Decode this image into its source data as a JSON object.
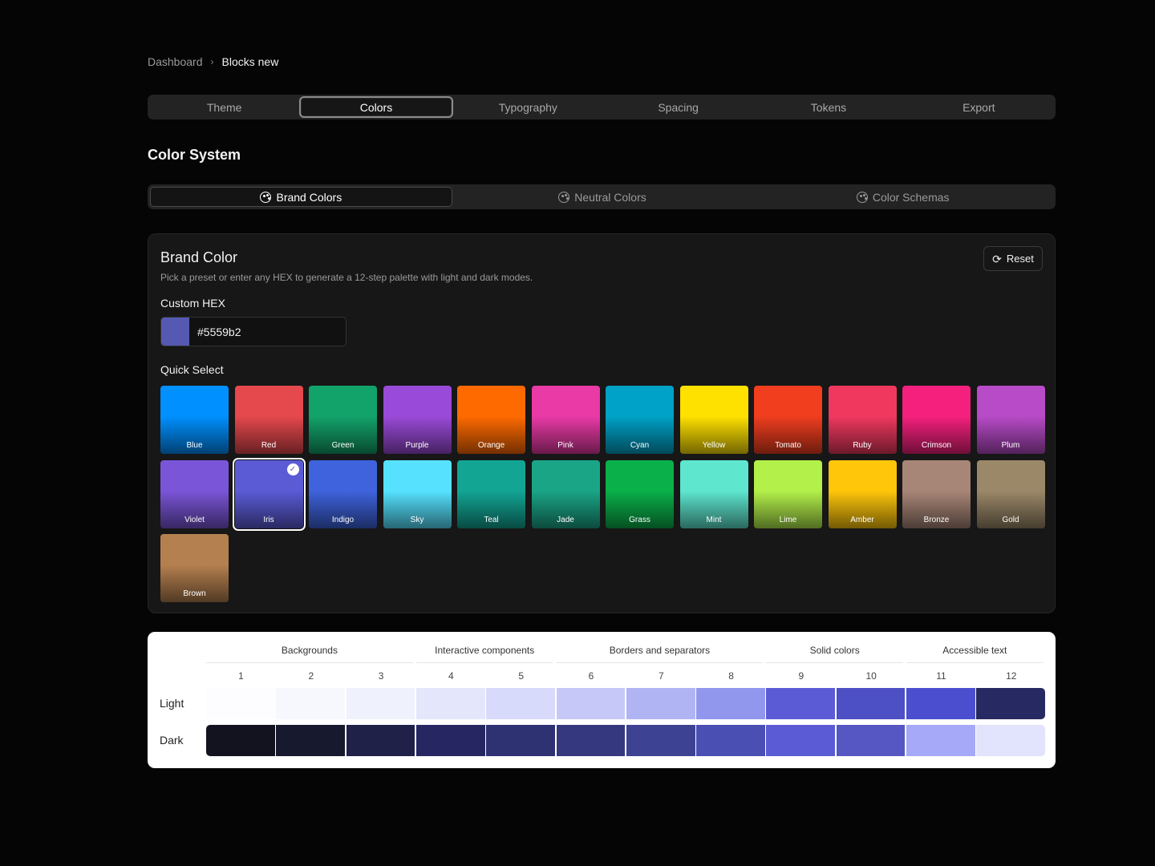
{
  "breadcrumb": {
    "root": "Dashboard",
    "separator": "›",
    "current": "Blocks new"
  },
  "main_tabs": [
    {
      "label": "Theme",
      "active": false
    },
    {
      "label": "Colors",
      "active": true
    },
    {
      "label": "Typography",
      "active": false
    },
    {
      "label": "Spacing",
      "active": false
    },
    {
      "label": "Tokens",
      "active": false
    },
    {
      "label": "Export",
      "active": false
    }
  ],
  "section_title": "Color System",
  "sub_tabs": [
    {
      "label": "Brand Colors",
      "icon": "palette-icon",
      "active": true
    },
    {
      "label": "Neutral Colors",
      "icon": "palette-icon",
      "active": false
    },
    {
      "label": "Color Schemas",
      "icon": "palette-icon",
      "active": false
    }
  ],
  "brand_card": {
    "title": "Brand Color",
    "description": "Pick a preset or enter any HEX to generate a 12-step palette with light and dark modes.",
    "reset_label": "Reset",
    "reset_icon": "refresh-icon",
    "hex_label": "Custom HEX",
    "hex_value": "#5559b2",
    "hex_swatch_color": "#5559b2",
    "quick_select_label": "Quick Select",
    "selected": "Iris",
    "presets": [
      {
        "name": "Blue",
        "color": "#0090ff"
      },
      {
        "name": "Red",
        "color": "#e5484d"
      },
      {
        "name": "Green",
        "color": "#12a36a"
      },
      {
        "name": "Purple",
        "color": "#9a4ad8"
      },
      {
        "name": "Orange",
        "color": "#ff6a00"
      },
      {
        "name": "Pink",
        "color": "#e93aa6"
      },
      {
        "name": "Cyan",
        "color": "#00a2c7"
      },
      {
        "name": "Yellow",
        "color": "#ffe100"
      },
      {
        "name": "Tomato",
        "color": "#f03e1f"
      },
      {
        "name": "Ruby",
        "color": "#f0385f"
      },
      {
        "name": "Crimson",
        "color": "#f5207d"
      },
      {
        "name": "Plum",
        "color": "#b84bc8"
      },
      {
        "name": "Violet",
        "color": "#7b55d8"
      },
      {
        "name": "Iris",
        "color": "#5b5bd6"
      },
      {
        "name": "Indigo",
        "color": "#3e63dd"
      },
      {
        "name": "Sky",
        "color": "#56e2ff"
      },
      {
        "name": "Teal",
        "color": "#12a594"
      },
      {
        "name": "Jade",
        "color": "#1aa587"
      },
      {
        "name": "Grass",
        "color": "#0ab04a"
      },
      {
        "name": "Mint",
        "color": "#5ee6cf"
      },
      {
        "name": "Lime",
        "color": "#b3f04a"
      },
      {
        "name": "Amber",
        "color": "#ffc60a"
      },
      {
        "name": "Bronze",
        "color": "#a88677"
      },
      {
        "name": "Gold",
        "color": "#9b8868"
      },
      {
        "name": "Brown",
        "color": "#b5804f"
      }
    ]
  },
  "scale": {
    "groups": [
      {
        "label": "Backgrounds",
        "span": 3
      },
      {
        "label": "Interactive components",
        "span": 2
      },
      {
        "label": "Borders and separators",
        "span": 3
      },
      {
        "label": "Solid colors",
        "span": 2
      },
      {
        "label": "Accessible text",
        "span": 2
      }
    ],
    "steps": [
      "1",
      "2",
      "3",
      "4",
      "5",
      "6",
      "7",
      "8",
      "9",
      "10",
      "11",
      "12"
    ],
    "rows": [
      {
        "label": "Light",
        "colors": [
          "#fdfdff",
          "#f7f8fe",
          "#eff1fd",
          "#e4e7fb",
          "#d7dafa",
          "#c6c9f7",
          "#b0b4f3",
          "#9297ee",
          "#5b5bd6",
          "#4d4fc4",
          "#4b4fcf",
          "#272962"
        ]
      },
      {
        "label": "Dark",
        "colors": [
          "#131320",
          "#171a2e",
          "#202149",
          "#262762",
          "#2e3172",
          "#35387f",
          "#3e4293",
          "#4a4fb3",
          "#5b5bd6",
          "#5657c2",
          "#a6a9f7",
          "#e2e3fc"
        ]
      }
    ]
  }
}
